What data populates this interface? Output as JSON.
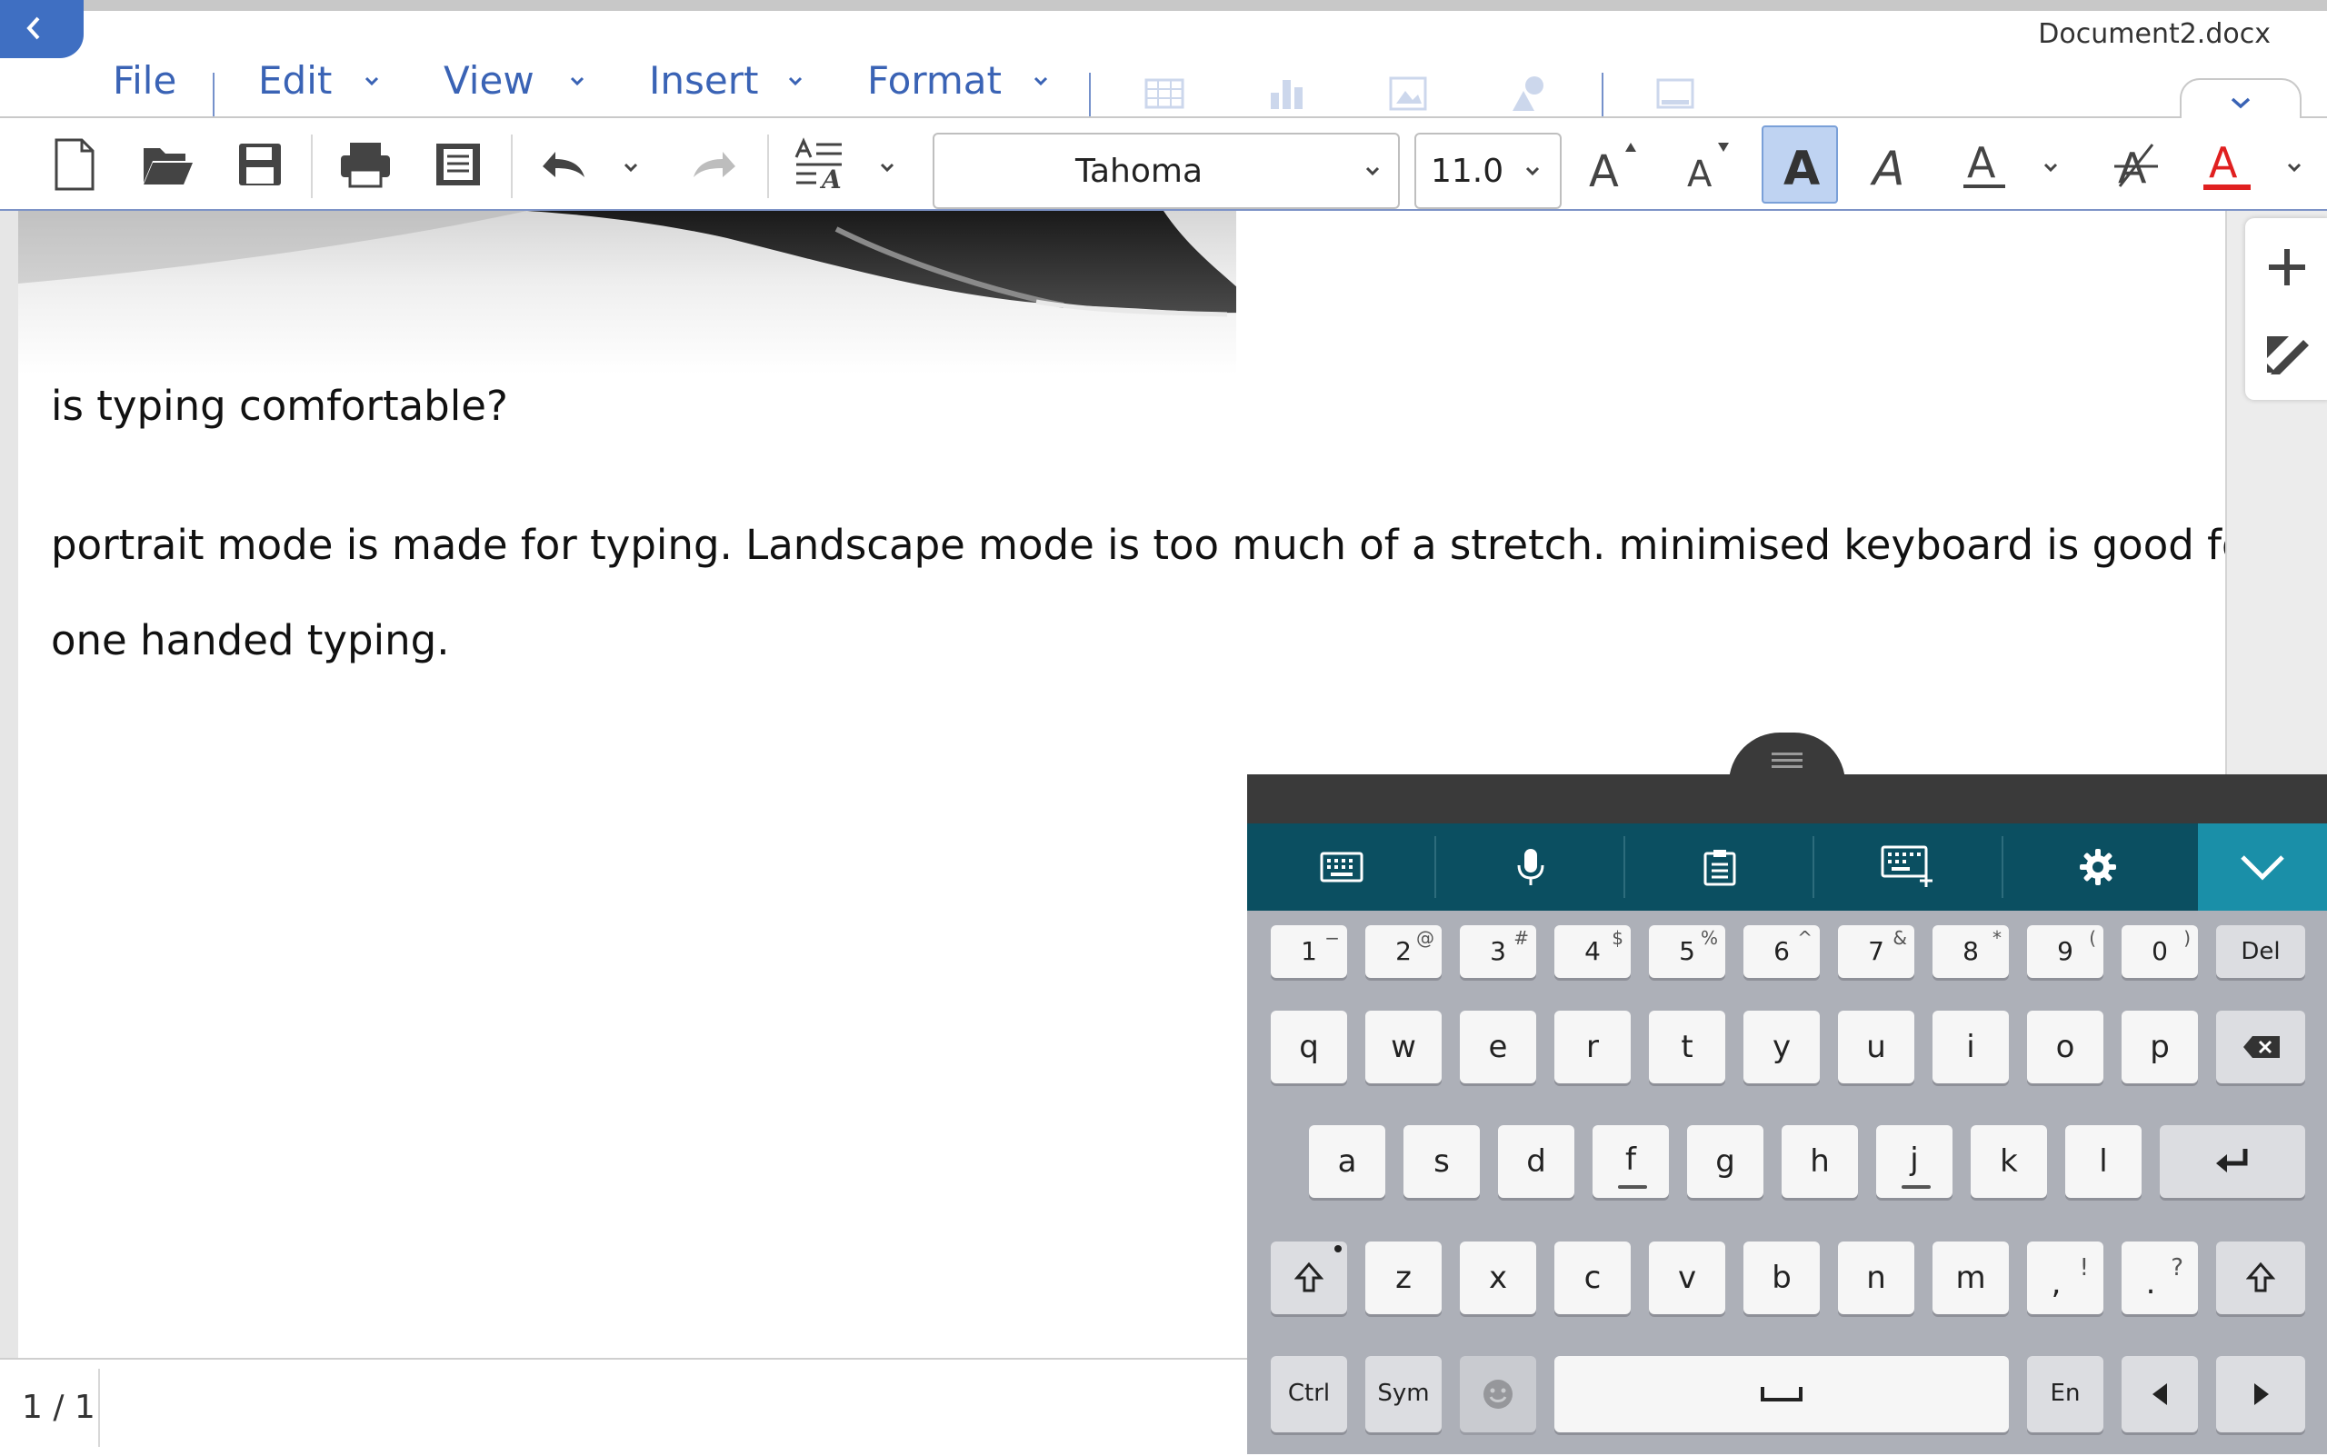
{
  "window": {
    "title": "Document2.docx"
  },
  "menu": {
    "items": [
      {
        "label": "File"
      },
      {
        "label": "Edit"
      },
      {
        "label": "View"
      },
      {
        "label": "Insert"
      },
      {
        "label": "Format"
      }
    ]
  },
  "toolbar": {
    "font_name": "Tahoma",
    "font_size": "11.0",
    "bold_active": true
  },
  "document": {
    "paragraphs": [
      "is typing comfortable?",
      "portrait mode is made for typing. Landscape mode is too much of a stretch. minimised keyboard is good for",
      "one handed typing."
    ]
  },
  "status": {
    "page_indicator": "1 / 1"
  },
  "keyboard": {
    "tools": [
      "keyboard-mode-icon",
      "microphone-icon",
      "clipboard-icon",
      "keyboard-resize-icon",
      "settings-icon",
      "hide-keyboard-icon"
    ],
    "number_row": [
      {
        "k": "1",
        "s": "−"
      },
      {
        "k": "2",
        "s": "@"
      },
      {
        "k": "3",
        "s": "#"
      },
      {
        "k": "4",
        "s": "$"
      },
      {
        "k": "5",
        "s": "%"
      },
      {
        "k": "6",
        "s": "^"
      },
      {
        "k": "7",
        "s": "&"
      },
      {
        "k": "8",
        "s": "*"
      },
      {
        "k": "9",
        "s": "("
      },
      {
        "k": "0",
        "s": ")"
      }
    ],
    "del_label": "Del",
    "row_q": [
      "q",
      "w",
      "e",
      "r",
      "t",
      "y",
      "u",
      "i",
      "o",
      "p"
    ],
    "row_a": [
      "a",
      "s",
      "d",
      "f",
      "g",
      "h",
      "j",
      "k",
      "l"
    ],
    "row_z": [
      "z",
      "x",
      "c",
      "v",
      "b",
      "n",
      "m"
    ],
    "comma": {
      "k": ",",
      "s": "!"
    },
    "period": {
      "k": ".",
      "s": "?"
    },
    "ctrl_label": "Ctrl",
    "sym_label": "Sym",
    "lang_label": "En"
  },
  "colors": {
    "accent": "#3a63b5",
    "keyboard_toolbar": "#0b4f61",
    "hide_button": "#1a8fa8",
    "font_color_underline": "#e02020"
  }
}
